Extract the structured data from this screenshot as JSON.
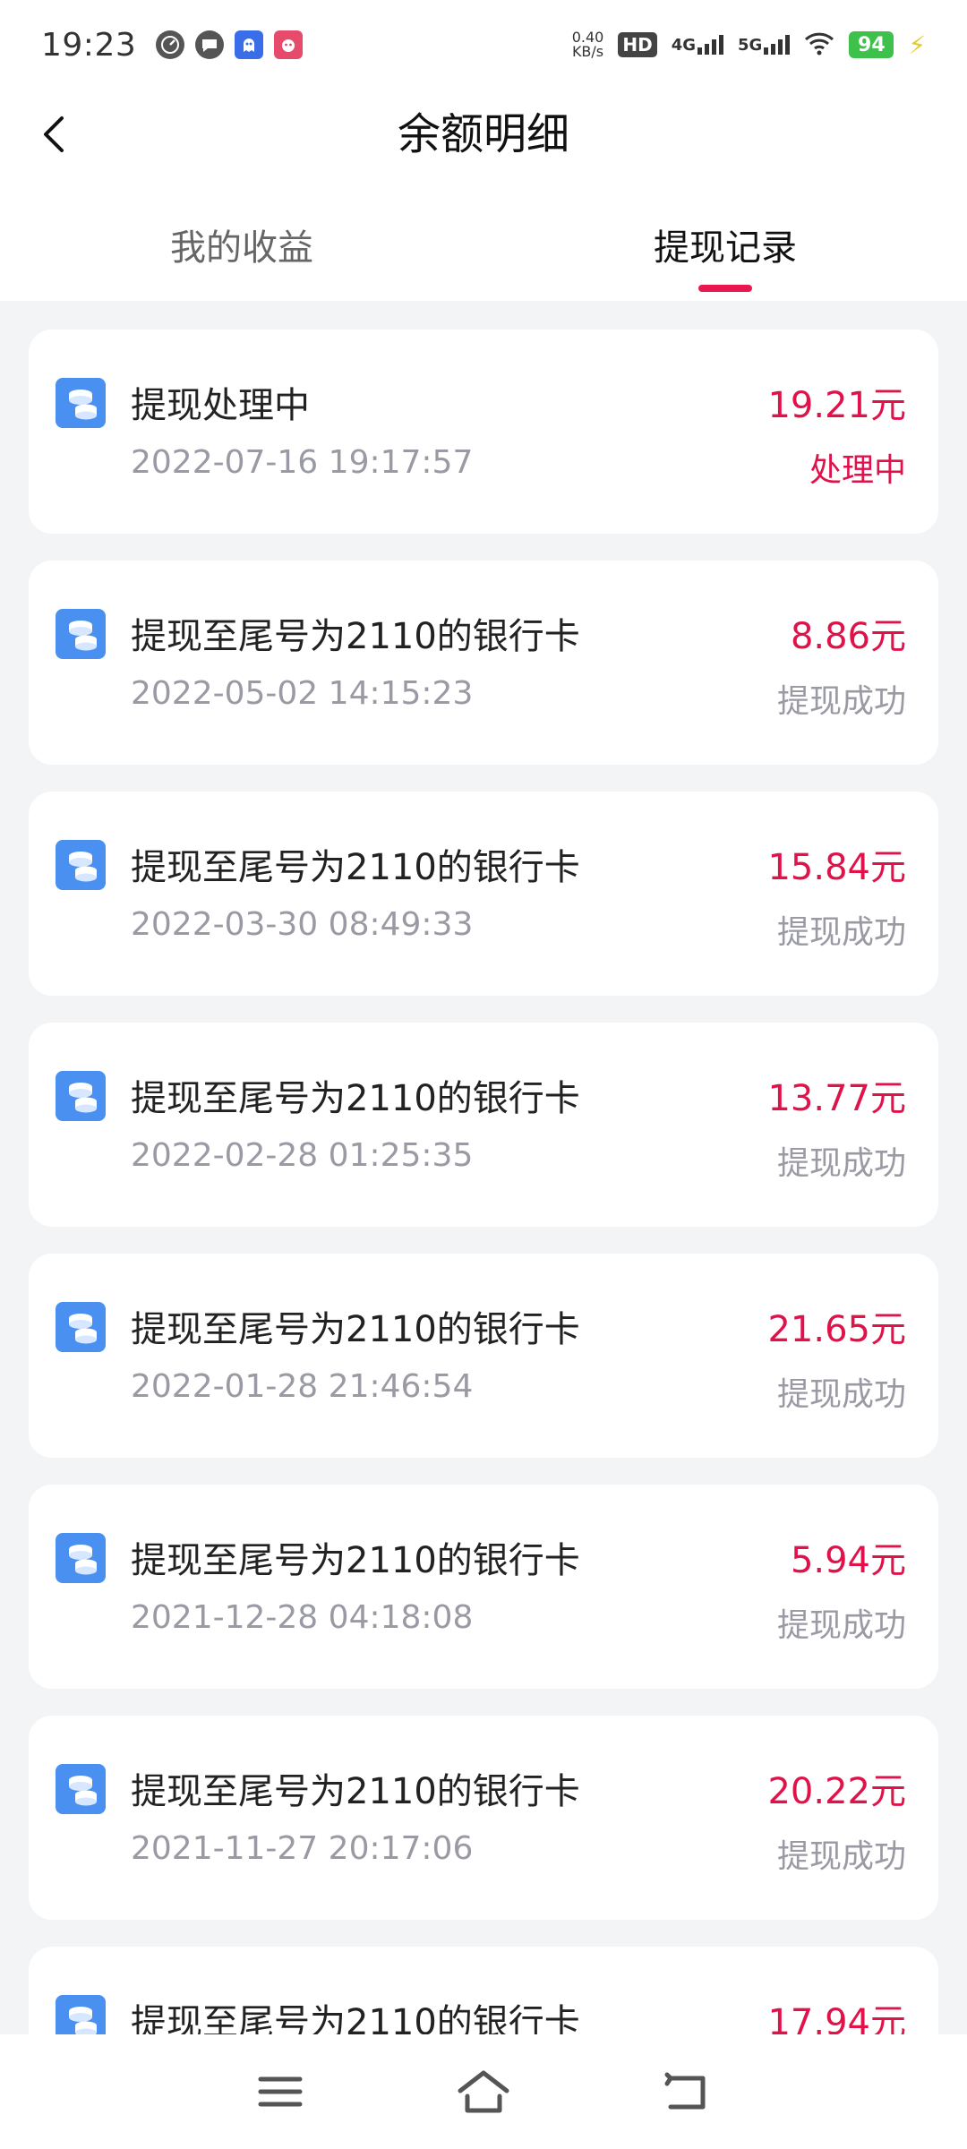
{
  "status_bar": {
    "time": "19:23",
    "net_speed_value": "0.40",
    "net_speed_unit": "KB/s",
    "hd_label": "HD",
    "sim1_label": "4G",
    "sim2_label": "5G",
    "battery": "94"
  },
  "header": {
    "title": "余额明细"
  },
  "tabs": [
    {
      "label": "我的收益",
      "active": false
    },
    {
      "label": "提现记录",
      "active": true
    }
  ],
  "records": [
    {
      "title": "提现处理中",
      "time": "2022-07-16 19:17:57",
      "amount": "19.21元",
      "status": "处理中"
    },
    {
      "title": "提现至尾号为2110的银行卡",
      "time": "2022-05-02 14:15:23",
      "amount": "8.86元",
      "status": "提现成功"
    },
    {
      "title": "提现至尾号为2110的银行卡",
      "time": "2022-03-30 08:49:33",
      "amount": "15.84元",
      "status": "提现成功"
    },
    {
      "title": "提现至尾号为2110的银行卡",
      "time": "2022-02-28 01:25:35",
      "amount": "13.77元",
      "status": "提现成功"
    },
    {
      "title": "提现至尾号为2110的银行卡",
      "time": "2022-01-28 21:46:54",
      "amount": "21.65元",
      "status": "提现成功"
    },
    {
      "title": "提现至尾号为2110的银行卡",
      "time": "2021-12-28 04:18:08",
      "amount": "5.94元",
      "status": "提现成功"
    },
    {
      "title": "提现至尾号为2110的银行卡",
      "time": "2021-11-27 20:17:06",
      "amount": "20.22元",
      "status": "提现成功"
    },
    {
      "title": "提现至尾号为2110的银行卡",
      "time": "",
      "amount": "17.94元",
      "status": ""
    }
  ],
  "colors": {
    "accent": "#e0124a",
    "icon_blue": "#4a90f0",
    "background": "#f3f4f6"
  }
}
